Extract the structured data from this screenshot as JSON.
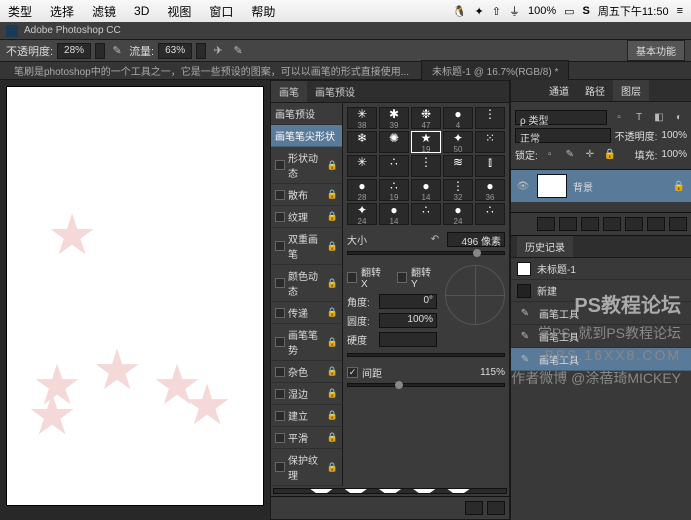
{
  "menubar": {
    "items": [
      "类型",
      "选择",
      "滤镜",
      "3D",
      "视图",
      "窗口",
      "帮助"
    ],
    "right": {
      "clock": "周五下午11:50",
      "icons": [
        "☰",
        "1",
        "100%",
        "☰",
        "S",
        "≡"
      ]
    }
  },
  "appbar": {
    "title": "Adobe Photoshop CC"
  },
  "optbar": {
    "opacity_label": "不透明度:",
    "opacity_value": "28%",
    "flow_label": "流量:",
    "flow_value": "63%",
    "basic": "基本功能"
  },
  "tabs": {
    "long": "笔刷是photoshop中的一个工具之一，它是一些预设的图案，可以以画笔的形式直接使用...",
    "doc": "未标题-1 @ 16.7%(RGB/8) *"
  },
  "brush_panel": {
    "tabs": [
      "画笔",
      "画笔预设"
    ],
    "list": [
      {
        "t": "画笔笔尖形状",
        "sel": true
      },
      {
        "t": "形状动态"
      },
      {
        "t": "散布"
      },
      {
        "t": "纹理"
      },
      {
        "t": "双重画笔"
      },
      {
        "t": "颜色动态"
      },
      {
        "t": "传递"
      },
      {
        "t": "画笔笔势"
      },
      {
        "t": "杂色"
      },
      {
        "t": "湿边"
      },
      {
        "t": "建立"
      },
      {
        "t": "平滑",
        "on": true
      },
      {
        "t": "保护纹理"
      }
    ],
    "thumbs": [
      {
        "g": "✳",
        "n": "38"
      },
      {
        "g": "✱",
        "n": "39"
      },
      {
        "g": "❉",
        "n": "47"
      },
      {
        "g": "●",
        "n": "4"
      },
      {
        "g": "⋮",
        "n": ""
      },
      {
        "g": "❄",
        "n": ""
      },
      {
        "g": "✺",
        "n": ""
      },
      {
        "g": "★",
        "n": "19",
        "sel": true
      },
      {
        "g": "✦",
        "n": "50"
      },
      {
        "g": "⁙",
        "n": ""
      },
      {
        "g": "✳",
        "n": ""
      },
      {
        "g": "∴",
        "n": ""
      },
      {
        "g": "⋮",
        "n": ""
      },
      {
        "g": "≋",
        "n": ""
      },
      {
        "g": "⫾",
        "n": ""
      },
      {
        "g": "●",
        "n": "28"
      },
      {
        "g": "∴",
        "n": "19"
      },
      {
        "g": "●",
        "n": "14"
      },
      {
        "g": "⋮",
        "n": "32"
      },
      {
        "g": "●",
        "n": "36"
      },
      {
        "g": "✦",
        "n": "24"
      },
      {
        "g": "●",
        "n": "14"
      },
      {
        "g": "∴",
        "n": ""
      },
      {
        "g": "●",
        "n": "24"
      },
      {
        "g": "∴",
        "n": ""
      }
    ],
    "size_label": "大小",
    "size_value": "496 像素",
    "flipx": "翻转 X",
    "flipy": "翻转 Y",
    "angle_label": "角度:",
    "angle_value": "0°",
    "round_label": "圆度:",
    "round_value": "100%",
    "hard_label": "硬度",
    "spacing_label": "间距",
    "spacing_value": "115%"
  },
  "right": {
    "tabs": [
      "通道",
      "路径",
      "图层"
    ],
    "kind": "ρ 类型",
    "mode": "正常",
    "opacity_label": "不透明度:",
    "opacity_value": "100%",
    "lock": "锁定:",
    "fill_label": "填充:",
    "fill_value": "100%",
    "layer_name": "背景"
  },
  "history": {
    "title": "历史记录",
    "doc": "未标题-1",
    "items": [
      "新建",
      "画笔工具",
      "画笔工具",
      "画笔工具"
    ]
  },
  "watermark": {
    "line1": "PS教程论坛",
    "line2": "学PS, 就到PS教程论坛",
    "line3": "BBS.16XX8.COM",
    "line4": "作者微博 @涂蓓琦MICKEY"
  }
}
